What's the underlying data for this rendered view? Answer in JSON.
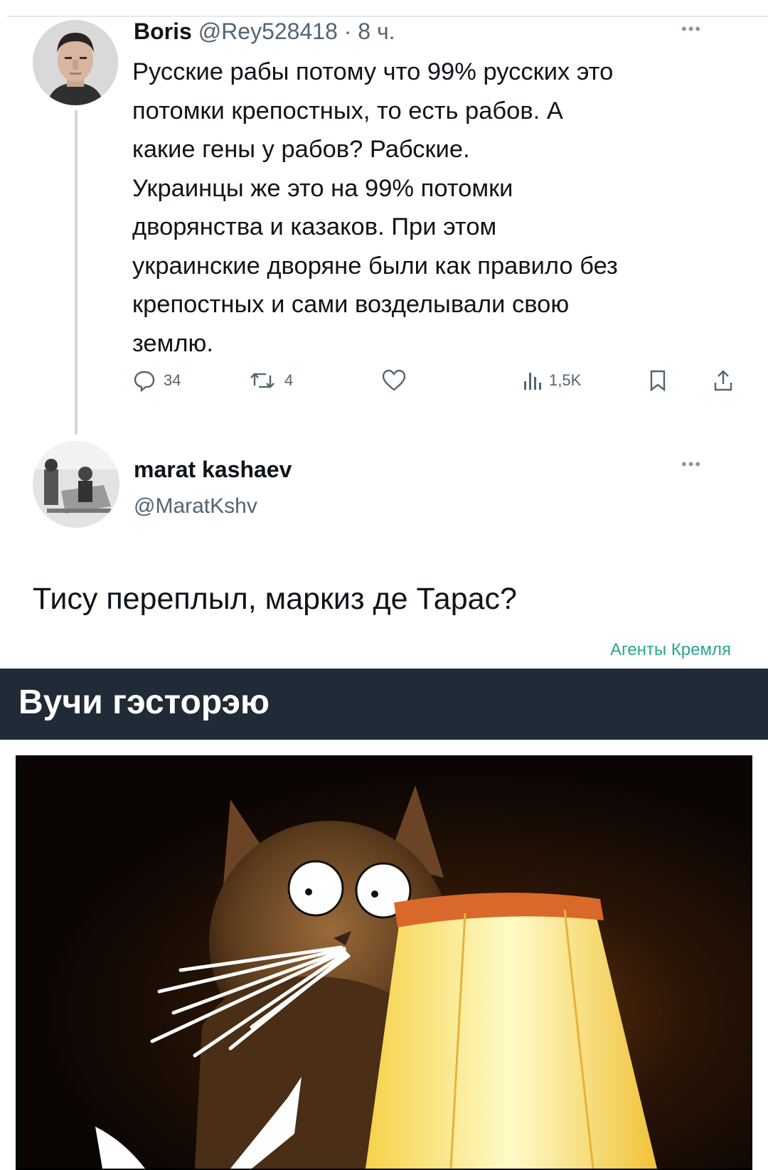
{
  "tweet": {
    "author_name": "Boris",
    "author_handle": "@Rey528418",
    "time": "· 8 ч.",
    "lines": [
      "Русские рабы потому что 99% русских это",
      "потомки крепостных, то есть рабов. А",
      "какие гены у рабов? Рабские.",
      "Украинцы же это на 99% потомки",
      "дворянства и казаков. При этом",
      "украинские дворяне были как правило без",
      "крепостных и сами возделывали свою",
      "землю."
    ],
    "more_icon": "more-dots-icon",
    "actions": {
      "reply_count": "34",
      "retweet_count": "4",
      "like_count": "",
      "views_count": "1,5K"
    }
  },
  "reply": {
    "author_name": "marat kashaev",
    "author_handle": "@MaratKshv",
    "text": "Тису переплыл, маркиз де Тарас?",
    "more_icon": "more-dots-icon"
  },
  "watermark": "Агенты Кремля",
  "banner": {
    "title": "Вучи гэсторэю"
  },
  "meme": {
    "subject": "cat-with-lampshade-image"
  },
  "colors": {
    "banner_bg": "#1f2b36",
    "watermark": "#2aa58d",
    "secondary_text": "#536471",
    "thread_line": "#cfd9de"
  }
}
